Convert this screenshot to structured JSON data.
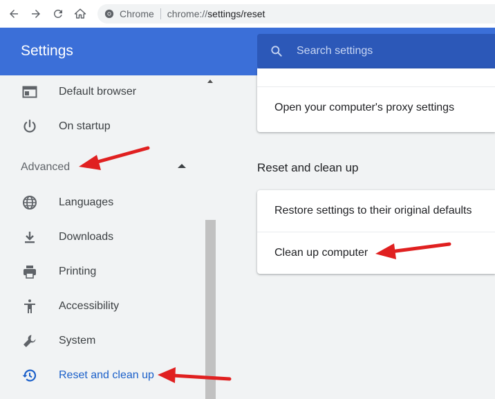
{
  "browser": {
    "nav_buttons": [
      "back",
      "forward",
      "reload",
      "home"
    ],
    "omnibox": {
      "site_chip": "Chrome",
      "url_scheme": "chrome://",
      "url_rest": "settings/reset"
    }
  },
  "header": {
    "title": "Settings",
    "search_placeholder": "Search settings"
  },
  "sidebar": {
    "items_top": [
      {
        "label": "Default browser",
        "icon": "browser-window-icon"
      },
      {
        "label": "On startup",
        "icon": "power-icon"
      }
    ],
    "advanced_label": "Advanced",
    "advanced_expanded": true,
    "items_advanced": [
      {
        "label": "Languages",
        "icon": "globe-icon"
      },
      {
        "label": "Downloads",
        "icon": "download-icon"
      },
      {
        "label": "Printing",
        "icon": "printer-icon"
      },
      {
        "label": "Accessibility",
        "icon": "accessibility-icon"
      },
      {
        "label": "System",
        "icon": "wrench-icon"
      },
      {
        "label": "Reset and clean up",
        "icon": "history-icon",
        "active": true
      }
    ]
  },
  "main": {
    "proxy_row": "Open your computer's proxy settings",
    "section_title": "Reset and clean up",
    "reset_rows": [
      "Restore settings to their original defaults",
      "Clean up computer"
    ]
  },
  "colors": {
    "header_blue": "#3b6fd8",
    "search_blue": "#2c58b8",
    "active_blue": "#1a5fc9",
    "annotation_red": "#e02020",
    "background": "#f1f3f4"
  }
}
